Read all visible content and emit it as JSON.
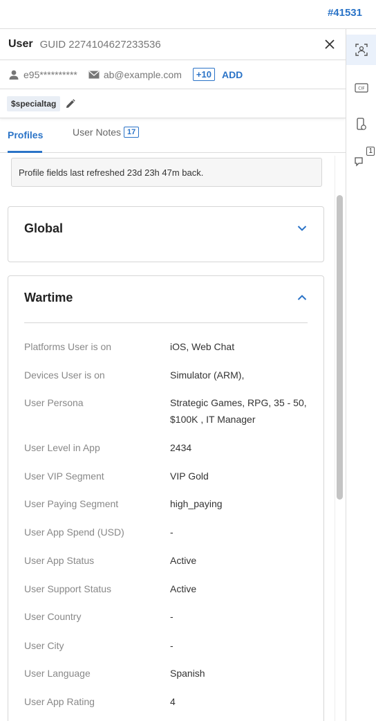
{
  "ticket_id": "#41531",
  "header": {
    "user_label": "User",
    "guid": "GUID 2274104627233536"
  },
  "identity": {
    "username": "e95**********",
    "email": "ab@example.com",
    "more_count": "+10",
    "add_label": "ADD"
  },
  "tags": [
    "$specialtag"
  ],
  "tabs": {
    "profiles": "Profiles",
    "notes": "User Notes",
    "notes_count": "17"
  },
  "notice": "Profile fields last refreshed 23d 23h 47m back.",
  "sections": [
    {
      "title": "Global",
      "expanded": false
    },
    {
      "title": "Wartime",
      "expanded": true
    }
  ],
  "fields": [
    {
      "label": "Platforms User is on",
      "value": "iOS, Web Chat"
    },
    {
      "label": "Devices User is on",
      "value": "Simulator (ARM),"
    },
    {
      "label": "User Persona",
      "value": "Strategic Games, RPG, 35 - 50, $100K , IT Manager"
    },
    {
      "label": "User Level in App",
      "value": "2434"
    },
    {
      "label": "User VIP Segment",
      "value": "VIP Gold"
    },
    {
      "label": "User Paying Segment",
      "value": "high_paying"
    },
    {
      "label": "User App Spend (USD)",
      "value": "-"
    },
    {
      "label": "User App Status",
      "value": "Active"
    },
    {
      "label": "User Support Status",
      "value": "Active"
    },
    {
      "label": "User Country",
      "value": "-"
    },
    {
      "label": "User City",
      "value": "-"
    },
    {
      "label": "User Language",
      "value": "Spanish"
    },
    {
      "label": "User App Rating",
      "value": "4"
    }
  ],
  "rail": {
    "chat_badge": "1"
  },
  "colors": {
    "accent": "#2a73c7"
  }
}
